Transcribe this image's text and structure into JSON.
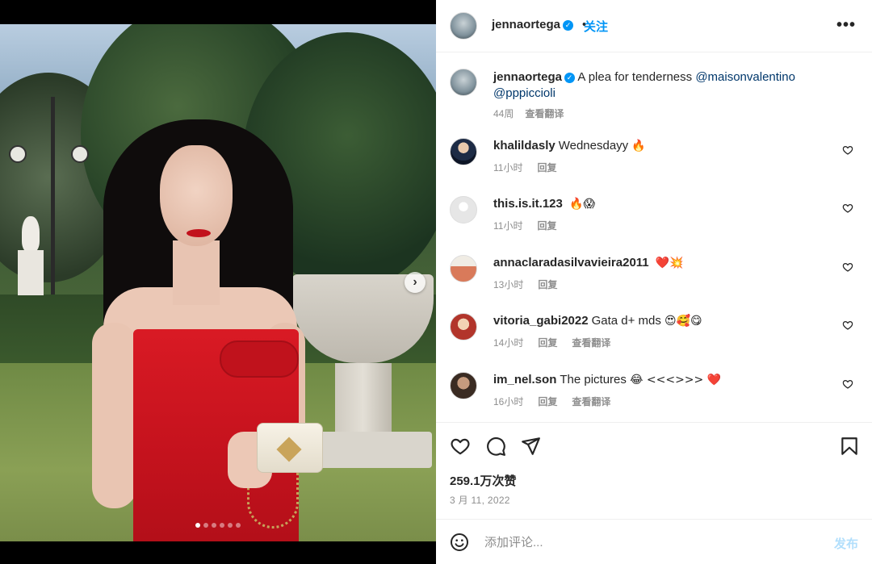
{
  "post": {
    "username": "jennaortega",
    "follow_label": "关注",
    "more_label": "•••",
    "caption_text": "A plea for tenderness",
    "caption_mentions": [
      "@maisonvalentino",
      "@pppiccioli"
    ],
    "caption_age": "44周",
    "translate_label": "查看翻译",
    "likes": "259.1万次赞",
    "date": "3 月 11, 2022",
    "carousel": {
      "total": 6,
      "active": 1
    }
  },
  "comments": [
    {
      "user": "khalildasly",
      "text": "Wednesdayy",
      "emoji": "🔥",
      "time": "11小时",
      "reply": "回复",
      "translate": ""
    },
    {
      "user": "this.is.it.123",
      "text": "",
      "emoji": "🔥😱",
      "time": "11小时",
      "reply": "回复",
      "translate": ""
    },
    {
      "user": "annaclaradasilvavieira2011",
      "text": "",
      "emoji": "❤️💥",
      "time": "13小时",
      "reply": "回复",
      "translate": ""
    },
    {
      "user": "vitoria_gabi2022",
      "text": "Gata d+ mds",
      "emoji": "😍🥰😋",
      "time": "14小时",
      "reply": "回复",
      "translate": "查看翻译"
    },
    {
      "user": "im_nel.son",
      "text": "The pictures",
      "emoji": "😂 <<<>>> ❤️",
      "time": "16小时",
      "reply": "回复",
      "translate": "查看翻译"
    }
  ],
  "composer": {
    "placeholder": "添加评论...",
    "post_label": "发布"
  },
  "icons": {
    "verified": "verified-badge-icon",
    "like": "heart-icon",
    "comment": "comment-bubble-icon",
    "share": "paper-plane-icon",
    "save": "bookmark-icon",
    "emoji": "emoji-smile-icon",
    "next": "chevron-right-icon"
  },
  "colors": {
    "accent": "#0095f6",
    "mention": "#00376b",
    "muted": "#8e8e8e",
    "post_disabled": "#b2dffc"
  }
}
